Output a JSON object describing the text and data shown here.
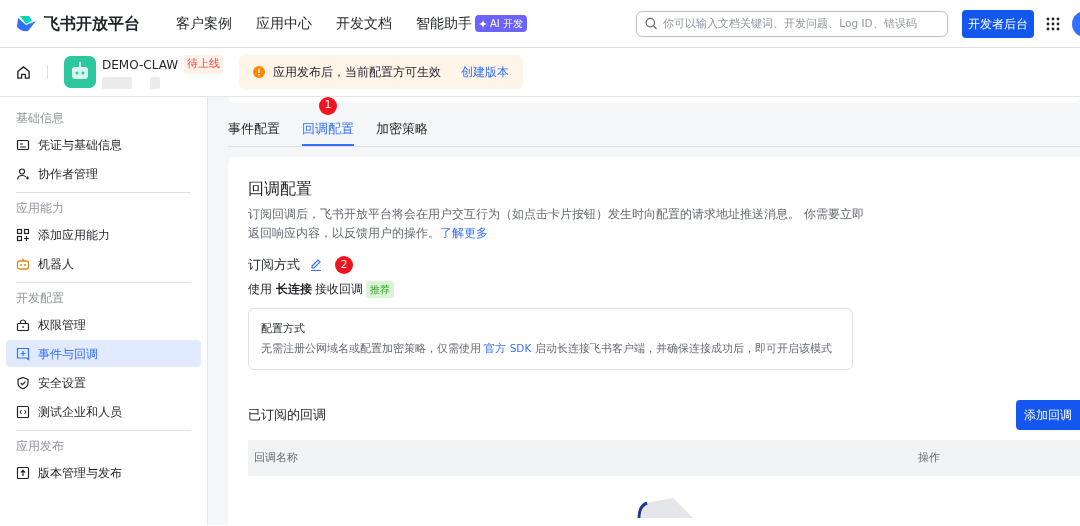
{
  "header": {
    "brand": "飞书开放平台",
    "nav": [
      {
        "label": "客户案例"
      },
      {
        "label": "应用中心"
      },
      {
        "label": "开发文档"
      },
      {
        "label": "智能助手",
        "badge": "AI 开发"
      }
    ],
    "search": {
      "placeholder": "你可以输入文档关键词、开发问题、Log ID、错误码"
    },
    "console_button": "开发者后台"
  },
  "app_bar": {
    "app_name": "DEMO-CLAW",
    "status": "待上线",
    "notice": "应用发布后，当前配置方可生效",
    "notice_link": "创建版本"
  },
  "sidebar": {
    "groups": [
      {
        "title": "基础信息",
        "items": [
          {
            "label": "凭证与基础信息",
            "selected": false
          },
          {
            "label": "协作者管理",
            "selected": false
          }
        ]
      },
      {
        "title": "应用能力",
        "items": [
          {
            "label": "添加应用能力",
            "selected": false
          },
          {
            "label": "机器人",
            "selected": false
          }
        ]
      },
      {
        "title": "开发配置",
        "items": [
          {
            "label": "权限管理",
            "selected": false
          },
          {
            "label": "事件与回调",
            "selected": true
          },
          {
            "label": "安全设置",
            "selected": false
          },
          {
            "label": "测试企业和人员",
            "selected": false
          }
        ]
      },
      {
        "title": "应用发布",
        "items": [
          {
            "label": "版本管理与发布",
            "selected": false
          }
        ]
      }
    ]
  },
  "tabs": [
    {
      "label": "事件配置",
      "selected": false
    },
    {
      "label": "回调配置",
      "selected": true,
      "marker": "1"
    },
    {
      "label": "加密策略",
      "selected": false
    }
  ],
  "panel": {
    "title": "回调配置",
    "description": "订阅回调后，飞书开放平台将会在用户交互行为（如点击卡片按钮）发生时向配置的请求地址推送消息。 你需要立即返回响应内容，以反馈用户的操作。",
    "learn_more": "了解更多",
    "subscription": {
      "title": "订阅方式",
      "marker": "2",
      "prefix": "使用",
      "mode": "长连接",
      "suffix": "接收回调",
      "tag": "推荐"
    },
    "config_box": {
      "title": "配置方式",
      "text_before": "无需注册公网域名或配置加密策略，仅需使用",
      "link": "官方 SDK",
      "text_after": "启动长连接飞书客户端，并确保连接成功后，即可开启该模式"
    },
    "subscribed": {
      "title": "已订阅的回调",
      "add_button": "添加回调",
      "columns": [
        "回调名称",
        "操作"
      ]
    }
  }
}
